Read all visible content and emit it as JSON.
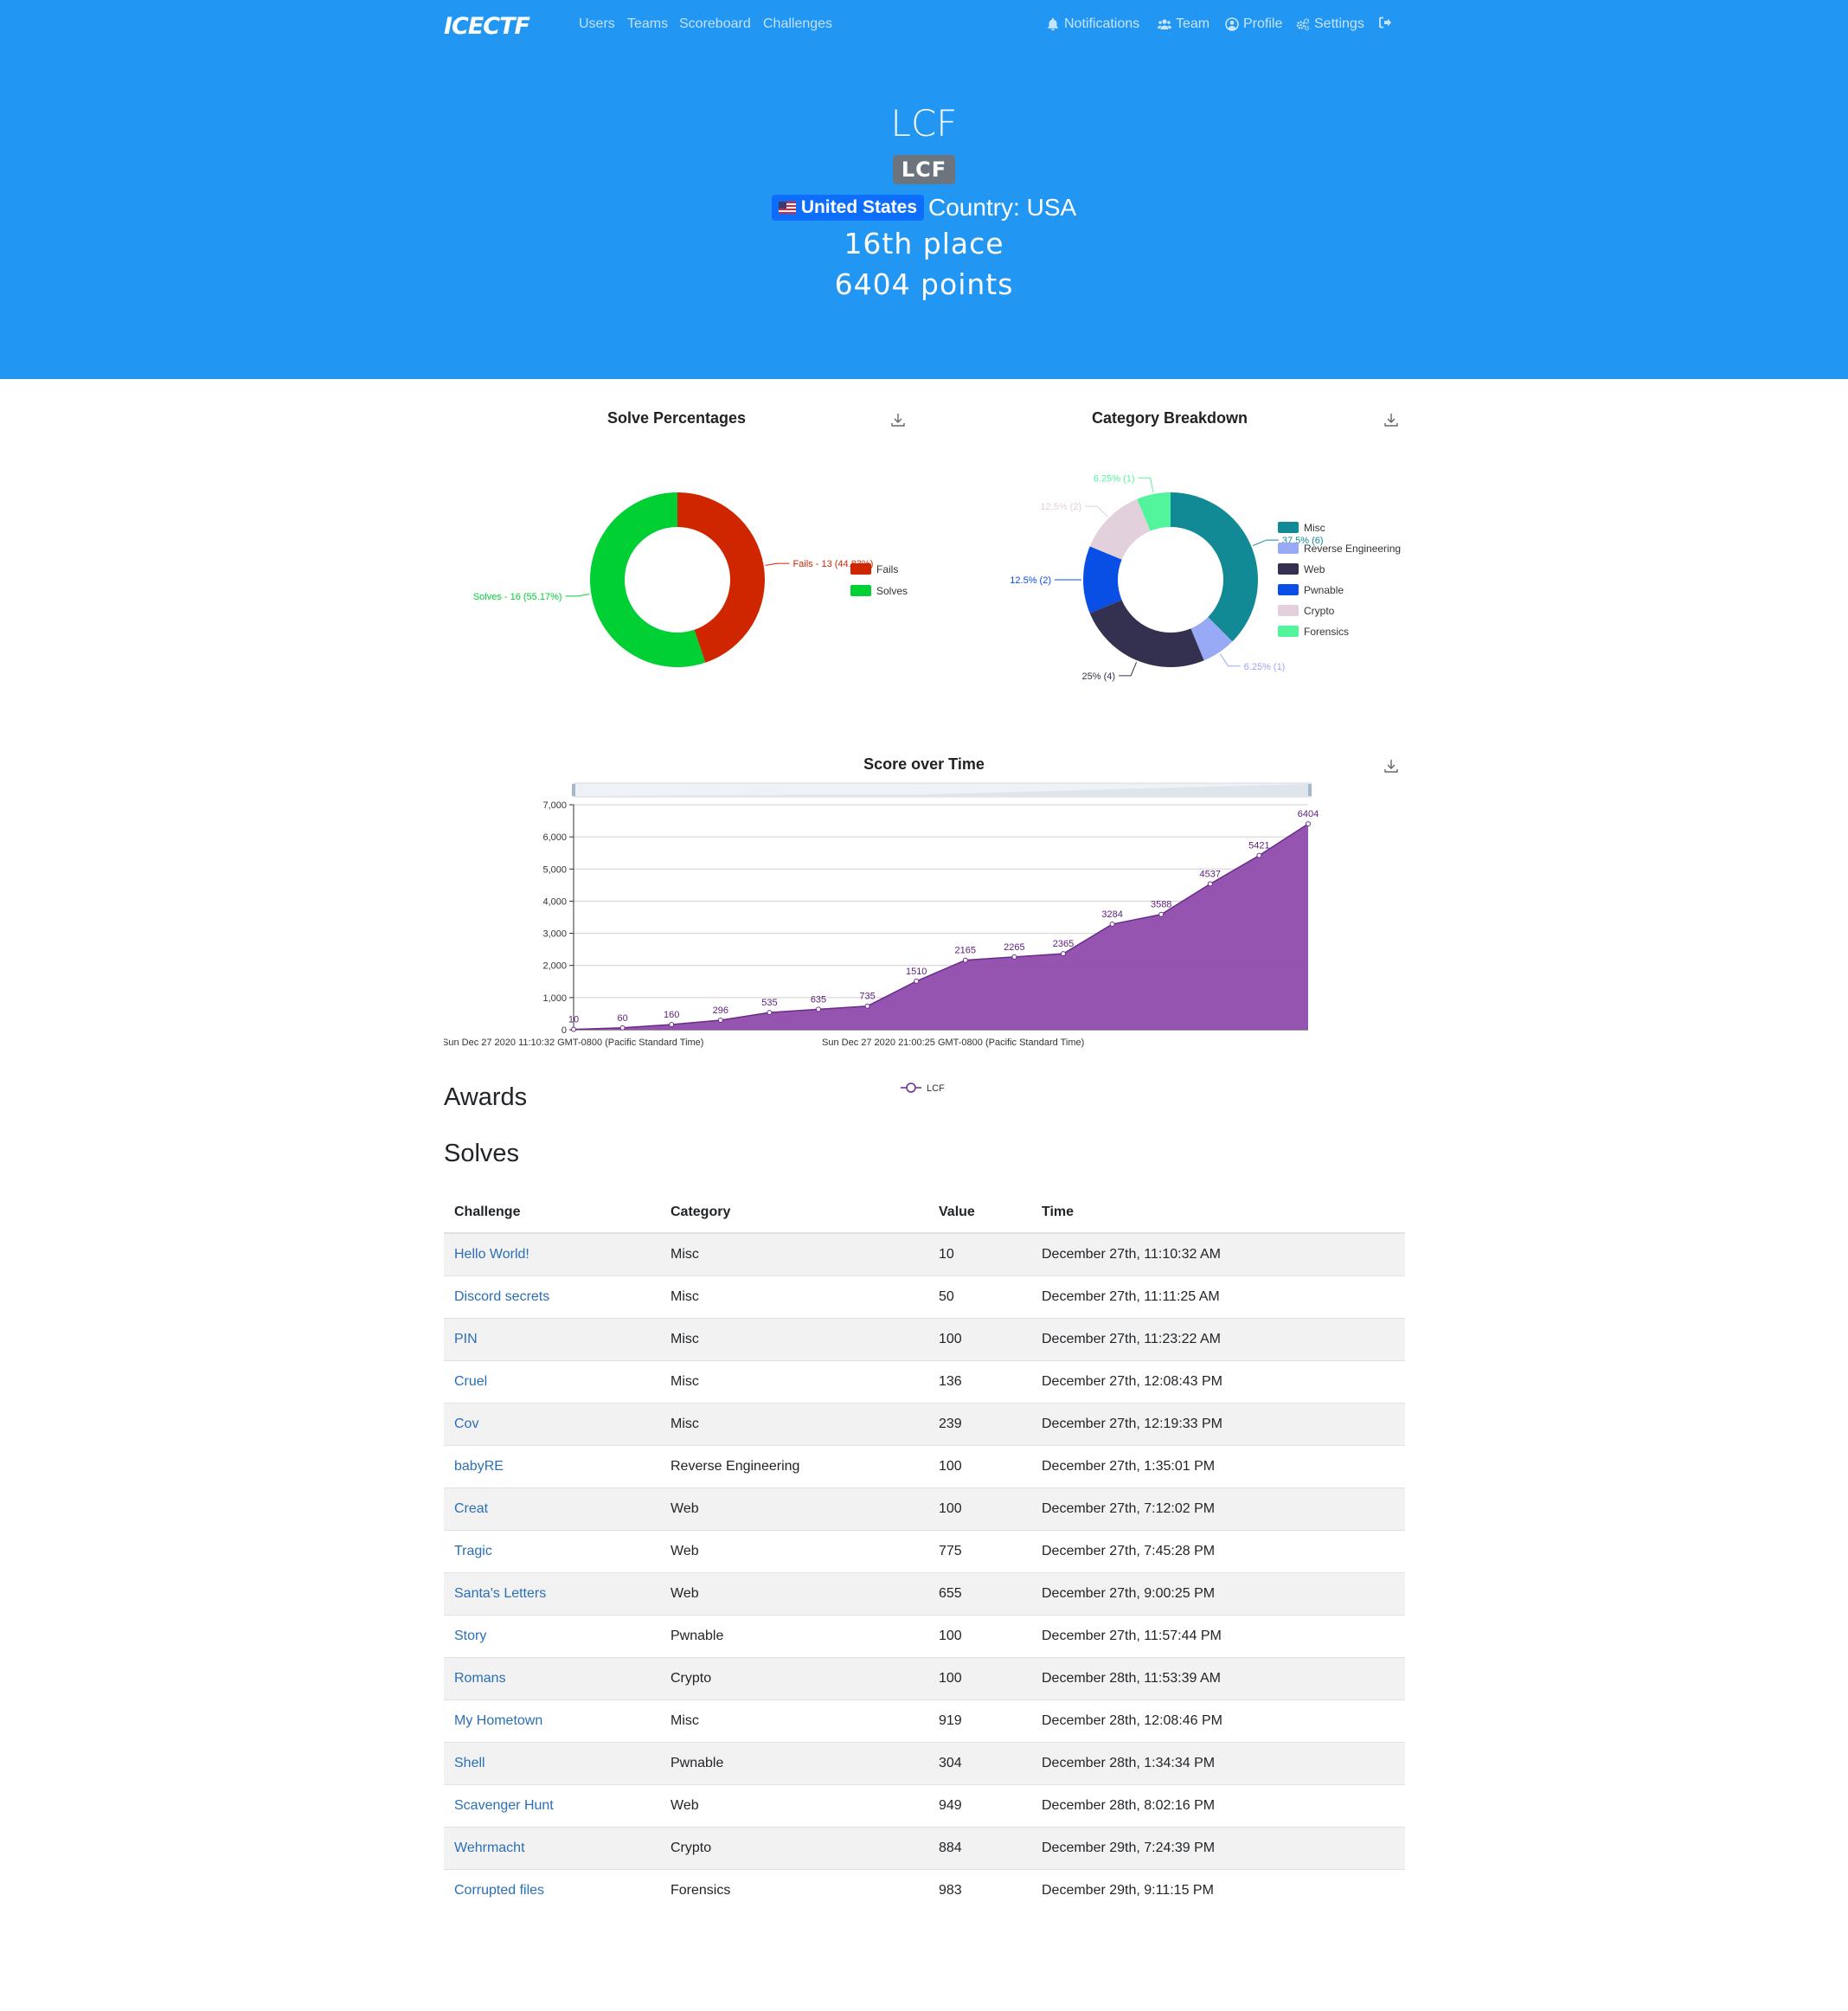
{
  "nav": {
    "logo": "ICECTF",
    "links": [
      "Users",
      "Teams",
      "Scoreboard",
      "Challenges"
    ],
    "right": [
      "Notifications",
      "Team",
      "Profile",
      "Settings"
    ]
  },
  "team": {
    "name": "LCF",
    "badge": "LCF",
    "country_badge": "United States",
    "country_text": "Country: USA",
    "place": "16th place",
    "points": "6404 points"
  },
  "charts": {
    "solve_title": "Solve Percentages",
    "category_title": "Category Breakdown",
    "score_title": "Score over Time"
  },
  "chart_data": [
    {
      "type": "pie",
      "title": "Solve Percentages",
      "labels": [
        "Fails",
        "Solves"
      ],
      "values": [
        13,
        16
      ],
      "data_labels": [
        "Fails - 13 (44.83%)",
        "Solves - 16 (55.17%)"
      ],
      "colors": [
        "#cf2600",
        "#00d034"
      ],
      "legend": "right"
    },
    {
      "type": "pie",
      "title": "Category Breakdown",
      "labels": [
        "Misc",
        "Reverse Engineering",
        "Web",
        "Pwnable",
        "Crypto",
        "Forensics"
      ],
      "values": [
        6,
        1,
        4,
        2,
        2,
        1
      ],
      "data_labels": [
        "37.5% (6)",
        "6.25% (1)",
        "25% (4)",
        "12.5% (2)",
        "12.5% (2)",
        "6.25% (1)"
      ],
      "colors": [
        "#118a95",
        "#98a9f5",
        "#333050",
        "#094fe6",
        "#e2d0dc",
        "#52f59c"
      ],
      "legend": "right"
    },
    {
      "type": "area",
      "title": "Score over Time",
      "series": [
        {
          "name": "LCF",
          "values": [
            10,
            60,
            160,
            296,
            535,
            635,
            735,
            1510,
            2165,
            2265,
            2365,
            3284,
            3588,
            4537,
            5421,
            6404
          ]
        }
      ],
      "x_tick_labels": [
        "Sun Dec 27 2020 11:10:32 GMT-0800 (Pacific Standard Time)",
        "Sun Dec 27 2020 21:00:25 GMT-0800 (Pacific Standard Time)"
      ],
      "y_ticks": [
        "0",
        "1,000",
        "2,000",
        "3,000",
        "4,000",
        "5,000",
        "6,000",
        "7,000"
      ],
      "ylim": [
        0,
        7000
      ],
      "color": "#8e4bab",
      "legend": "bottom"
    }
  ],
  "sections": {
    "awards": "Awards",
    "solves": "Solves"
  },
  "table": {
    "headers": [
      "Challenge",
      "Category",
      "Value",
      "Time"
    ],
    "rows": [
      [
        "Hello World!",
        "Misc",
        "10",
        "December 27th, 11:10:32 AM"
      ],
      [
        "Discord secrets",
        "Misc",
        "50",
        "December 27th, 11:11:25 AM"
      ],
      [
        "PIN",
        "Misc",
        "100",
        "December 27th, 11:23:22 AM"
      ],
      [
        "Cruel",
        "Misc",
        "136",
        "December 27th, 12:08:43 PM"
      ],
      [
        "Cov",
        "Misc",
        "239",
        "December 27th, 12:19:33 PM"
      ],
      [
        "babyRE",
        "Reverse Engineering",
        "100",
        "December 27th, 1:35:01 PM"
      ],
      [
        "Creat",
        "Web",
        "100",
        "December 27th, 7:12:02 PM"
      ],
      [
        "Tragic",
        "Web",
        "775",
        "December 27th, 7:45:28 PM"
      ],
      [
        "Santa's Letters",
        "Web",
        "655",
        "December 27th, 9:00:25 PM"
      ],
      [
        "Story",
        "Pwnable",
        "100",
        "December 27th, 11:57:44 PM"
      ],
      [
        "Romans",
        "Crypto",
        "100",
        "December 28th, 11:53:39 AM"
      ],
      [
        "My Hometown",
        "Misc",
        "919",
        "December 28th, 12:08:46 PM"
      ],
      [
        "Shell",
        "Pwnable",
        "304",
        "December 28th, 1:34:34 PM"
      ],
      [
        "Scavenger Hunt",
        "Web",
        "949",
        "December 28th, 8:02:16 PM"
      ],
      [
        "Wehrmacht",
        "Crypto",
        "884",
        "December 29th, 7:24:39 PM"
      ],
      [
        "Corrupted files",
        "Forensics",
        "983",
        "December 29th, 9:11:15 PM"
      ]
    ]
  }
}
